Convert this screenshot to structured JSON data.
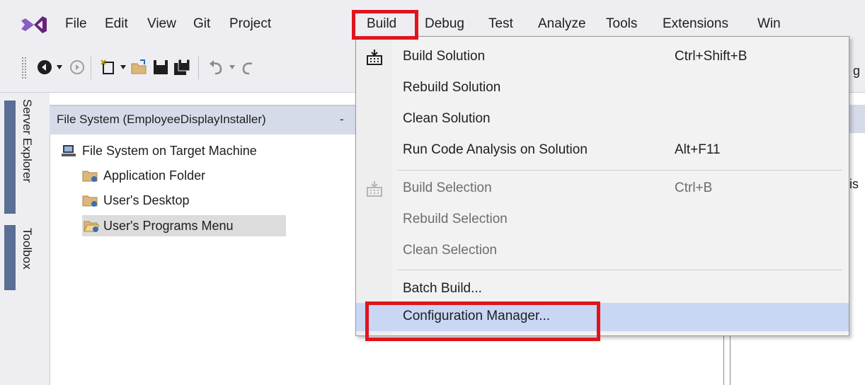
{
  "menubar": {
    "items": [
      {
        "label": "File"
      },
      {
        "label": "Edit"
      },
      {
        "label": "View"
      },
      {
        "label": "Git"
      },
      {
        "label": "Project"
      },
      {
        "label": "Build"
      },
      {
        "label": "Debug"
      },
      {
        "label": "Test"
      },
      {
        "label": "Analyze"
      },
      {
        "label": "Tools"
      },
      {
        "label": "Extensions"
      },
      {
        "label": "Win"
      }
    ]
  },
  "leftdock": {
    "tabs": [
      {
        "label": "Server Explorer"
      },
      {
        "label": "Toolbox"
      }
    ]
  },
  "document": {
    "tab_label": "File System (EmployeeDisplayInstaller)",
    "tab_suffix": "-",
    "tree": [
      {
        "label": "File System on Target Machine",
        "icon": "computer-icon"
      },
      {
        "label": "Application Folder",
        "icon": "folder-icon"
      },
      {
        "label": "User's Desktop",
        "icon": "folder-icon"
      },
      {
        "label": "User's Programs Menu",
        "icon": "open-folder-icon"
      }
    ]
  },
  "right_fragments": {
    "toolbar_clip": "g",
    "pane_clip": "is"
  },
  "build_menu": {
    "items": [
      {
        "label": "Build Solution",
        "shortcut": "Ctrl+Shift+B",
        "enabled": true,
        "icon": "build-icon"
      },
      {
        "label": "Rebuild Solution",
        "shortcut": "",
        "enabled": true
      },
      {
        "label": "Clean Solution",
        "shortcut": "",
        "enabled": true
      },
      {
        "label": "Run Code Analysis on Solution",
        "shortcut": "Alt+F11",
        "enabled": true
      },
      {
        "label": "Build Selection",
        "shortcut": "Ctrl+B",
        "enabled": false,
        "icon": "build-icon"
      },
      {
        "label": "Rebuild Selection",
        "shortcut": "",
        "enabled": false
      },
      {
        "label": "Clean Selection",
        "shortcut": "",
        "enabled": false
      },
      {
        "label": "Batch Build...",
        "shortcut": "",
        "enabled": true
      },
      {
        "label": "Configuration Manager...",
        "shortcut": "",
        "enabled": true,
        "highlighted": true
      }
    ]
  },
  "colors": {
    "accent_purple": "#68217a",
    "highlight_red": "#e0141c",
    "menu_hover": "#c9d6f4",
    "chrome": "#eeeef2"
  }
}
